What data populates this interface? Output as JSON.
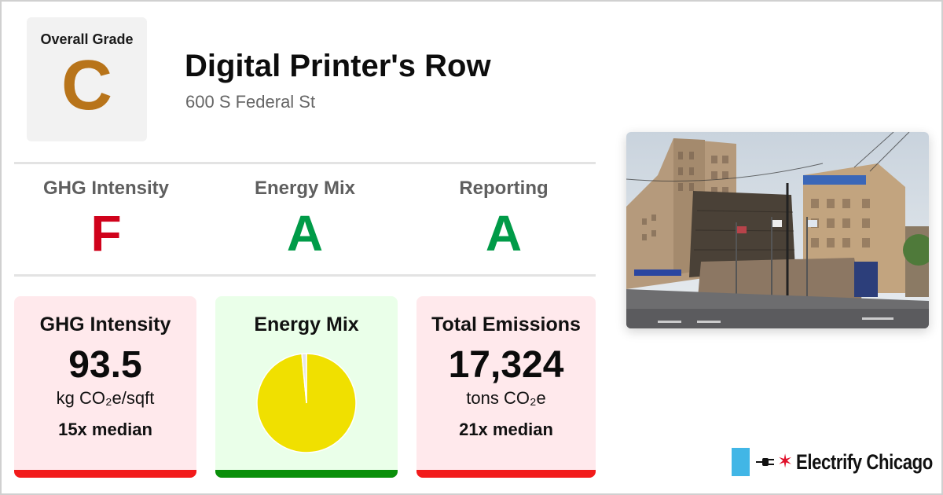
{
  "overall": {
    "label": "Overall Grade",
    "grade": "C",
    "color": "#b8741a"
  },
  "building": {
    "name": "Digital Printer's Row",
    "address": "600 S Federal St"
  },
  "subgrades": [
    {
      "label": "GHG Intensity",
      "grade": "F",
      "color": "#d0021b"
    },
    {
      "label": "Energy Mix",
      "grade": "A",
      "color": "#009b48"
    },
    {
      "label": "Reporting",
      "grade": "A",
      "color": "#009b48"
    }
  ],
  "cards": {
    "ghg": {
      "title": "GHG Intensity",
      "value": "93.5",
      "unit": "kg CO₂e/sqft",
      "median": "15x median",
      "bg": "#ffe9ec",
      "bar": "#f21b1b"
    },
    "mix": {
      "title": "Energy Mix",
      "bg": "#eaffe9",
      "bar": "#0a8f0a"
    },
    "total": {
      "title": "Total Emissions",
      "value": "17,324",
      "unit": "tons CO₂e",
      "median": "21x median",
      "bg": "#ffe9ec",
      "bar": "#f21b1b"
    }
  },
  "chart_data": {
    "type": "pie",
    "title": "",
    "slices": [
      {
        "value": 98.5,
        "color": "#f0e000"
      },
      {
        "value": 1.5,
        "color": "#e6e6e6"
      }
    ]
  },
  "photo": {
    "icon": "building-photo"
  },
  "brand": {
    "name": "Electrify Chicago",
    "flag_color": "#41b6e6",
    "star_color": "#e0102a",
    "star_glyph": "✶"
  }
}
